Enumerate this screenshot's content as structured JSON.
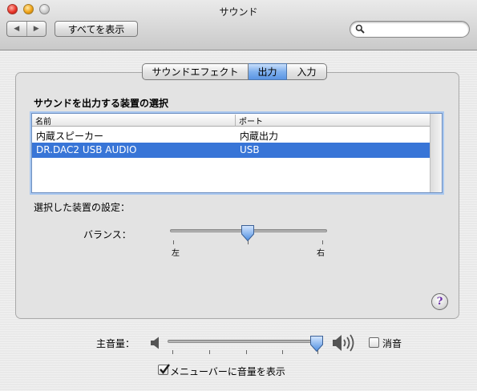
{
  "window": {
    "title": "サウンド"
  },
  "toolbar": {
    "back_glyph": "◀",
    "forward_glyph": "▶",
    "show_all_label": "すべてを表示",
    "search_placeholder": "",
    "search_icon": "search-icon"
  },
  "tabs": [
    {
      "label": "サウンドエフェクト",
      "selected": false
    },
    {
      "label": "出力",
      "selected": true
    },
    {
      "label": "入力",
      "selected": false
    }
  ],
  "output": {
    "heading": "サウンドを出力する装置の選択",
    "columns": {
      "name": "名前",
      "port": "ポート"
    },
    "devices": [
      {
        "name": "内蔵スピーカー",
        "port": "内蔵出力",
        "selected": false
      },
      {
        "name": "DR.DAC2 USB AUDIO",
        "port": "USB",
        "selected": true
      }
    ],
    "settings_label": "選択した装置の設定：",
    "balance": {
      "label": "バランス：",
      "left_label": "左",
      "right_label": "右",
      "value_fraction": 0.5
    }
  },
  "help_button_label": "?",
  "volume": {
    "label": "主音量：",
    "value_fraction": 0.97,
    "min_icon": "speaker-low-icon",
    "max_icon": "speaker-high-icon"
  },
  "mute": {
    "label": "消音",
    "checked": false
  },
  "menubar_option": {
    "label": "メニューバーに音量を表示",
    "checked": true
  },
  "colors": {
    "selection": "#3875d7",
    "tab_selected": "#7fb0ee"
  }
}
